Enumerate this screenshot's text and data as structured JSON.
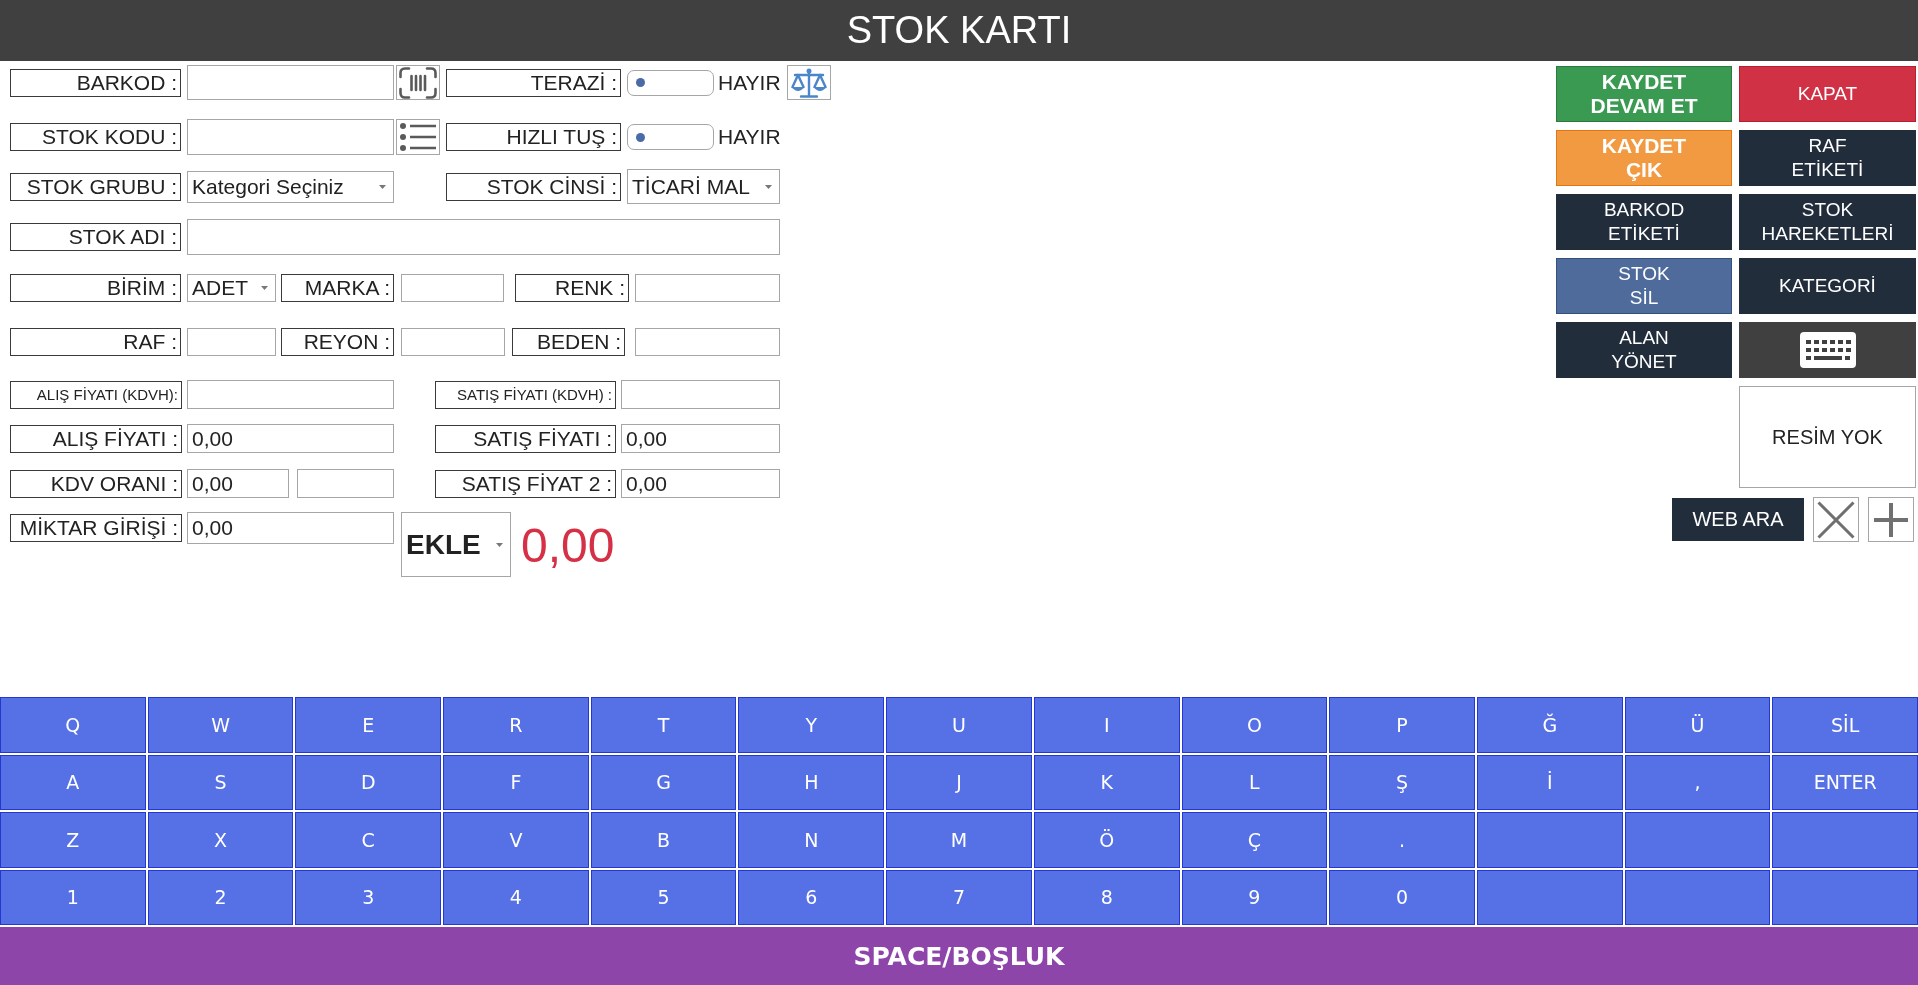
{
  "window": {
    "title": "STOK KARTI"
  },
  "form": {
    "barcode": {
      "label": "BARKOD :"
    },
    "scale": {
      "label": "TERAZİ :",
      "on": false,
      "state_text": "HAYIR"
    },
    "stock_code": {
      "label": "STOK KODU :"
    },
    "hotkey": {
      "label": "HIZLI TUŞ :",
      "on": false,
      "state_text": "HAYIR"
    },
    "stock_group": {
      "label": "STOK GRUBU :",
      "value": "Kategori Seçiniz"
    },
    "stock_type": {
      "label": "STOK CİNSİ :",
      "value": "TİCARİ MAL"
    },
    "stock_name": {
      "label": "STOK ADI :"
    },
    "unit": {
      "label": "BİRİM :",
      "value": "ADET"
    },
    "brand": {
      "label": "MARKA :"
    },
    "colour": {
      "label": "RENK :"
    },
    "shelf": {
      "label": "RAF :"
    },
    "aisle": {
      "label": "REYON :"
    },
    "size": {
      "label": "BEDEN :"
    },
    "purchase_price_net": {
      "label": "ALIŞ FİYATI (KDVH):"
    },
    "sale_price_net": {
      "label": "SATIŞ FİYATI (KDVH) :"
    },
    "purchase_price": {
      "label": "ALIŞ FİYATI :",
      "value": "0,00"
    },
    "sale_price": {
      "label": "SATIŞ FİYATI :",
      "value": "0,00"
    },
    "vat_rate": {
      "label": "KDV ORANI :",
      "value": "0,00"
    },
    "sale_price_2": {
      "label": "SATIŞ FİYAT 2 :",
      "value": "0,00"
    },
    "quantity": {
      "label": "MİKTAR GİRİŞİ :",
      "value": "0,00",
      "mode": "EKLE"
    },
    "total": "0,00"
  },
  "actions": [
    {
      "label": "KAYDET\nDEVAM ET",
      "kind": "save"
    },
    {
      "label": "KAPAT",
      "kind": "close"
    },
    {
      "label": "KAYDET\nÇIK",
      "kind": "save_exit"
    },
    {
      "label": "RAF\nETİKETİ",
      "kind": "dark"
    },
    {
      "label": "BARKOD\nETİKETİ",
      "kind": "dark"
    },
    {
      "label": "STOK\nHAREKETLERİ",
      "kind": "dark"
    },
    {
      "label": "STOK\nSİL",
      "kind": "delete"
    },
    {
      "label": "KATEGORİ",
      "kind": "dark"
    },
    {
      "label": "ALAN\nYÖNET",
      "kind": "dark"
    },
    {
      "kind": "keyboard"
    }
  ],
  "image": {
    "text": "RESİM YOK"
  },
  "web_search": {
    "label": "WEB ARA"
  },
  "keyboard": {
    "rows": [
      [
        "Q",
        "W",
        "E",
        "R",
        "T",
        "Y",
        "U",
        "I",
        "O",
        "P",
        "Ğ",
        "Ü",
        "SİL"
      ],
      [
        "A",
        "S",
        "D",
        "F",
        "G",
        "H",
        "J",
        "K",
        "L",
        "Ş",
        "İ",
        ",",
        "ENTER"
      ],
      [
        "Z",
        "X",
        "C",
        "V",
        "B",
        "N",
        "M",
        "Ö",
        "Ç",
        "."
      ],
      [
        "1",
        "2",
        "3",
        "4",
        "5",
        "6",
        "7",
        "8",
        "9",
        "0"
      ]
    ],
    "space": "SPACE/BOŞLUK"
  }
}
